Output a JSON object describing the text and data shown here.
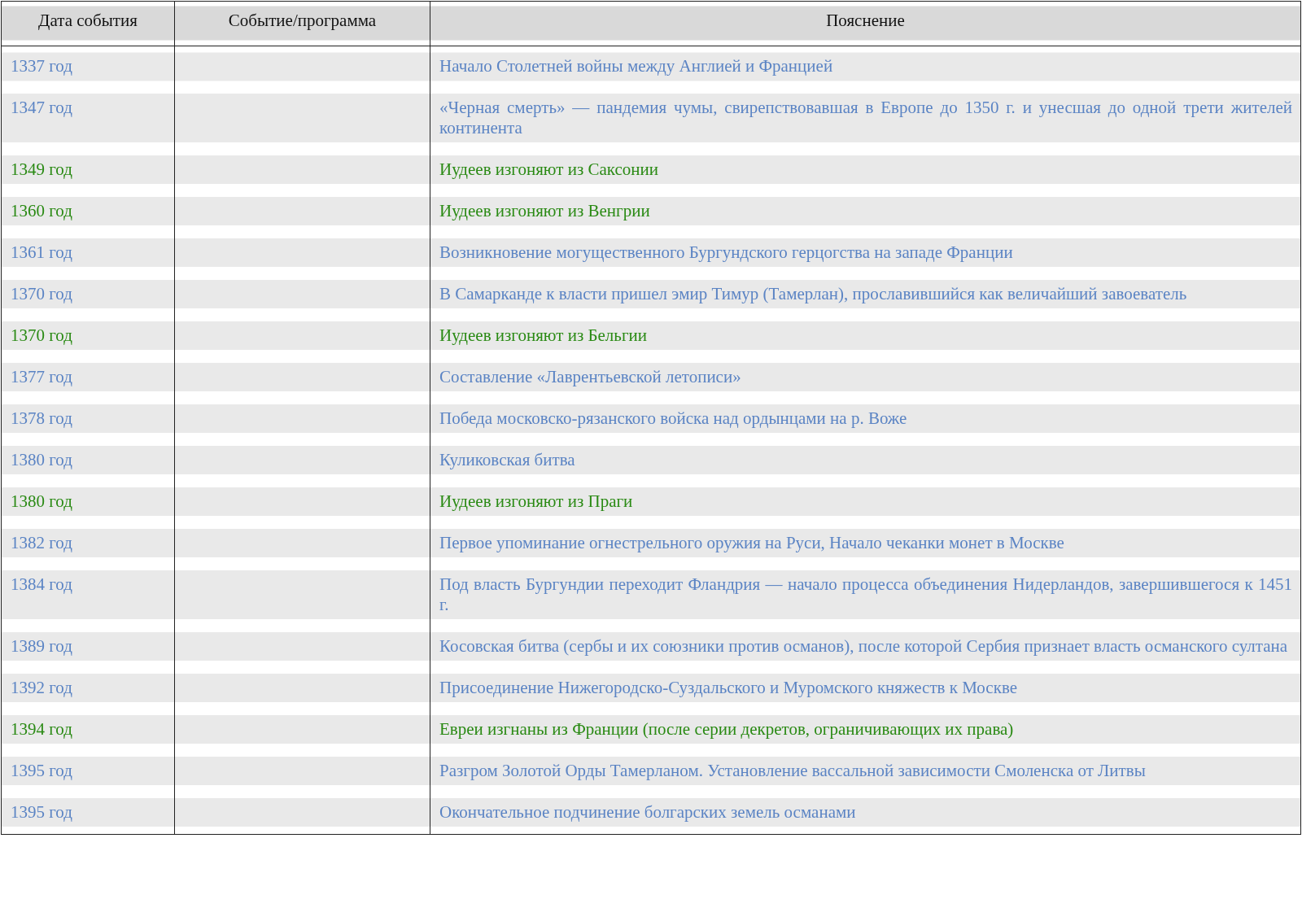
{
  "table": {
    "columns": [
      "Дата события",
      "Событие/программа",
      "Пояснение"
    ],
    "rows": [
      {
        "date": "1337 год",
        "explanation": "Начало Столетней войны между Англией и Францией",
        "color": "#5b84c4"
      },
      {
        "date": "1347 год",
        "explanation": "«Черная смерть» — пандемия чумы, свирепствовавшая в Европе до 1350 г. и унесшая до одной трети жителей континента",
        "color": "#5b84c4"
      },
      {
        "date": "1349 год",
        "explanation": "Иудеев изгоняют из Саксонии",
        "color": "#2a8a14"
      },
      {
        "date": "1360 год",
        "explanation": "Иудеев изгоняют из Венгрии",
        "color": "#2a8a14"
      },
      {
        "date": "1361 год",
        "explanation": "Возникновение могущественного Бургундского герцогства на западе Франции",
        "color": "#5b84c4"
      },
      {
        "date": "1370 год",
        "explanation": "В Самарканде к власти пришел эмир Тимур (Тамерлан), прославившийся как величайший завоеватель",
        "color": "#5b84c4"
      },
      {
        "date": "1370 год",
        "explanation": "Иудеев изгоняют из Бельгии",
        "color": "#2a8a14"
      },
      {
        "date": "1377 год",
        "explanation": "Составление «Лаврентьевской летописи»",
        "color": "#5b84c4"
      },
      {
        "date": "1378 год",
        "explanation": "Победа московско-рязанского войска над ордынцами на р. Воже",
        "color": "#5b84c4"
      },
      {
        "date": "1380 год",
        "explanation": "Куликовская битва",
        "color": "#5b84c4"
      },
      {
        "date": "1380 год",
        "explanation": "Иудеев изгоняют из Праги",
        "color": "#2a8a14"
      },
      {
        "date": "1382 год",
        "explanation": "Первое упоминание огнестрельного оружия на Руси, Начало чеканки монет в Москве",
        "color": "#5b84c4"
      },
      {
        "date": "1384 год",
        "explanation": "Под власть Бургундии переходит Фландрия — начало процесса объединения Нидерландов, завершившегося к 1451 г.",
        "color": "#5b84c4"
      },
      {
        "date": "1389 год",
        "explanation": "Косовская битва (сербы и их союзники против османов), после которой Сербия признает власть османского султана",
        "color": "#5b84c4"
      },
      {
        "date": "1392 год",
        "explanation": "Присоединение Нижегородско-Суздальского и Муромского княжеств к Москве",
        "color": "#5b84c4"
      },
      {
        "date": "1394 год",
        "explanation": "Евреи изгнаны из Франции (после серии декретов, ограничивающих их права)",
        "color": "#2a8a14"
      },
      {
        "date": "1395 год",
        "explanation": "Разгром Золотой Орды Тамерланом. Установление вассальной зависимости Смоленска от Литвы",
        "color": "#5b84c4"
      },
      {
        "date": "1395 год",
        "explanation": "Окончательное подчинение болгарских земель османами",
        "color": "#5b84c4"
      }
    ]
  }
}
